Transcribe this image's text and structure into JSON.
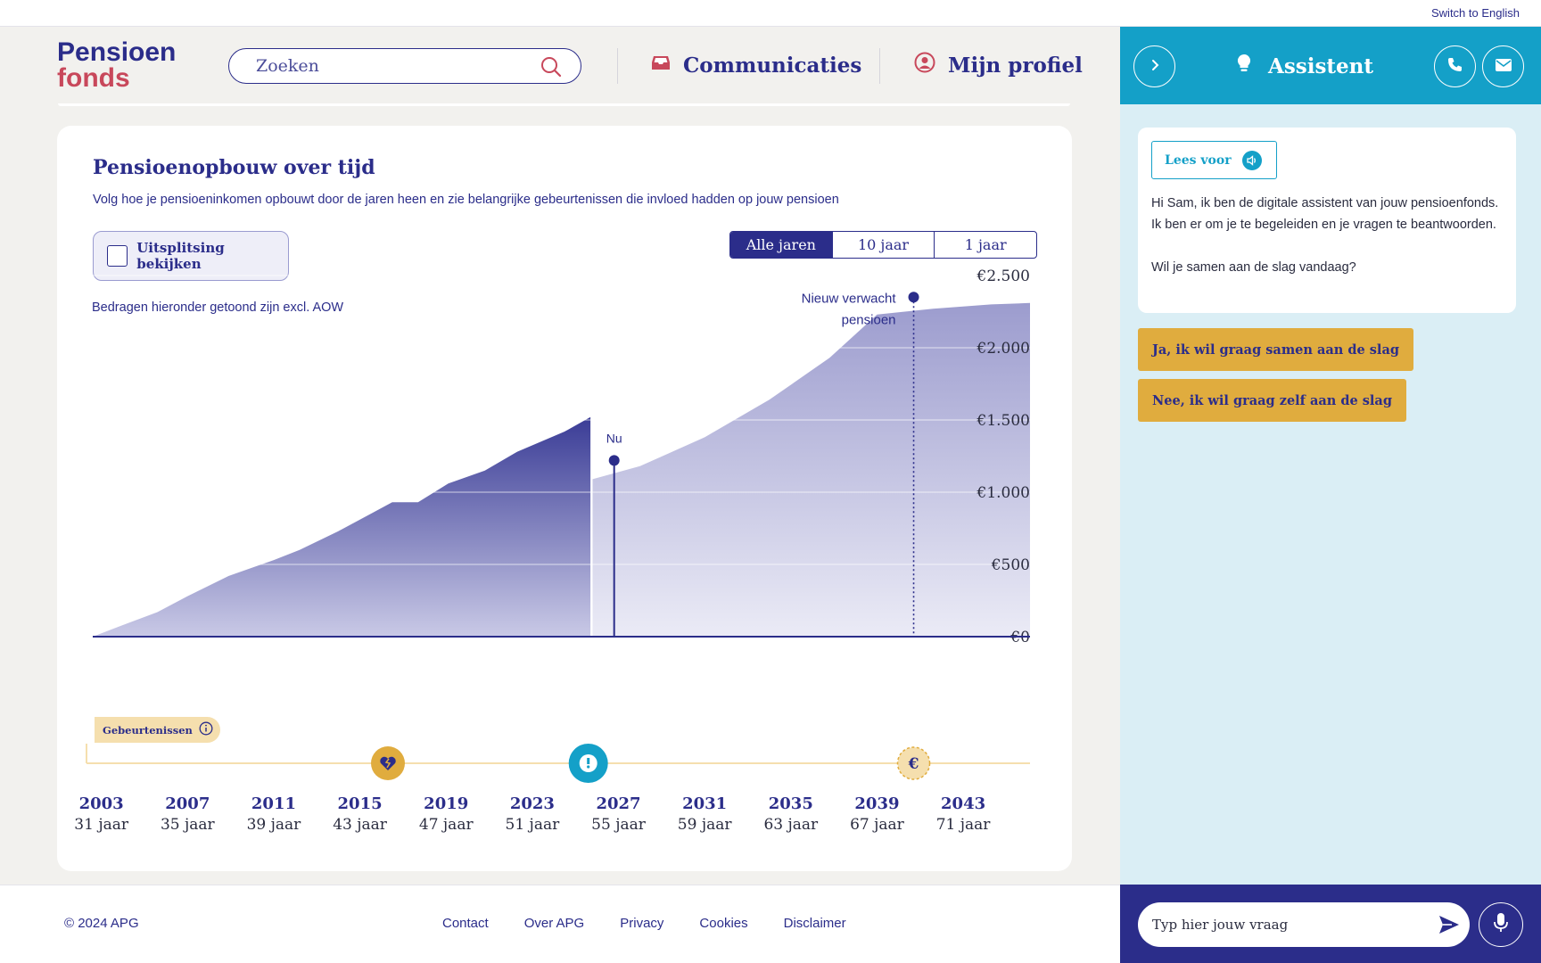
{
  "topbar": {
    "switch_language": "Switch to English"
  },
  "header": {
    "logo_line1": "Pensioen",
    "logo_line2": "fonds",
    "search_placeholder": "Zoeken",
    "nav": {
      "communications": "Communicaties",
      "profile": "Mijn profiel"
    }
  },
  "assistant": {
    "title": "Assistent",
    "read_aloud": "Lees voor",
    "message_p1": "Hi Sam, ik ben de digitale assistent van jouw pensioenfonds. Ik ben er om je te begeleiden en je vragen te beantwoorden.",
    "message_p2": "Wil je samen aan de slag vandaag?",
    "replies": [
      "Ja, ik wil graag samen aan de slag",
      "Nee, ik wil graag zelf aan de slag"
    ],
    "input_placeholder": "Typ hier jouw vraag"
  },
  "main": {
    "title": "Pensioenopbouw over tijd",
    "subtitle": "Volg hoe je pensioeninkomen opbouwt door de jaren heen en zie belangrijke gebeurtenissen die invloed hadden op jouw pensioen",
    "breakdown_label": "Uitsplitsing bekijken",
    "range_options": [
      "Alle jaren",
      "10 jaar",
      "1 jaar"
    ],
    "active_range": "Alle jaren",
    "aow_note": "Bedragen hieronder getoond zijn excl. AOW",
    "events_label": "Gebeurtenissen"
  },
  "chart_data": {
    "type": "area",
    "ylim": [
      0,
      2500
    ],
    "y_ticks": [
      0,
      500,
      1000,
      1500,
      2000,
      2500
    ],
    "y_tick_labels": [
      "€0",
      "€500",
      "€1.000",
      "€1.500",
      "€2.000",
      "€2.500"
    ],
    "x_ticks": [
      2003,
      2007,
      2011,
      2015,
      2019,
      2023,
      2027,
      2031,
      2035,
      2039,
      2043
    ],
    "x_tick_years": [
      "2003",
      "2007",
      "2011",
      "2015",
      "2019",
      "2023",
      "2027",
      "2031",
      "2035",
      "2039",
      "2043"
    ],
    "x_tick_ages": [
      "31 jaar",
      "35 jaar",
      "39 jaar",
      "43 jaar",
      "47 jaar",
      "51 jaar",
      "55 jaar",
      "59 jaar",
      "63 jaar",
      "67 jaar",
      "71 jaar"
    ],
    "x_range": [
      2002.6,
      2046.1
    ],
    "series": [
      {
        "kind": "actual",
        "x": [
          2002.6,
          2004,
          2005.6,
          2007,
          2008.9,
          2011,
          2012.2,
          2014,
          2015.5,
          2016.5,
          2017.7,
          2019.1,
          2020.8,
          2022.3,
          2024.5,
          2025.7
        ],
        "y": [
          0,
          80,
          170,
          280,
          420,
          530,
          600,
          730,
          850,
          930,
          930,
          1060,
          1150,
          1280,
          1420,
          1520
        ]
      },
      {
        "kind": "expected",
        "x": [
          2025.8,
          2028,
          2031,
          2034,
          2036.8,
          2039,
          2041.6,
          2044.3,
          2046.1
        ],
        "y": [
          1090,
          1180,
          1380,
          1640,
          1930,
          2230,
          2270,
          2300,
          2310
        ]
      }
    ],
    "markers": [
      {
        "label": "Nu",
        "x": 2026.8,
        "y": 1220
      },
      {
        "label": "Nieuw verwacht pensioen",
        "x": 2040.7,
        "y": 2350
      }
    ],
    "events": [
      {
        "x": 2016.3,
        "icon": "broken-heart-icon",
        "color": "#e0ac3e"
      },
      {
        "x": 2025.6,
        "icon": "exclamation-icon",
        "color": "#14a0c8"
      },
      {
        "x": 2040.7,
        "icon": "euro-icon",
        "color": "#f5dfae"
      }
    ]
  },
  "footer": {
    "copyright": "© 2024 APG",
    "links": [
      "Contact",
      "Over APG",
      "Privacy",
      "Cookies",
      "Disclaimer"
    ]
  },
  "colors": {
    "primary": "#2b2d8a",
    "accent": "#14a0c8",
    "logo_red": "#c8485b",
    "reply_yellow": "#e0ac3e"
  }
}
